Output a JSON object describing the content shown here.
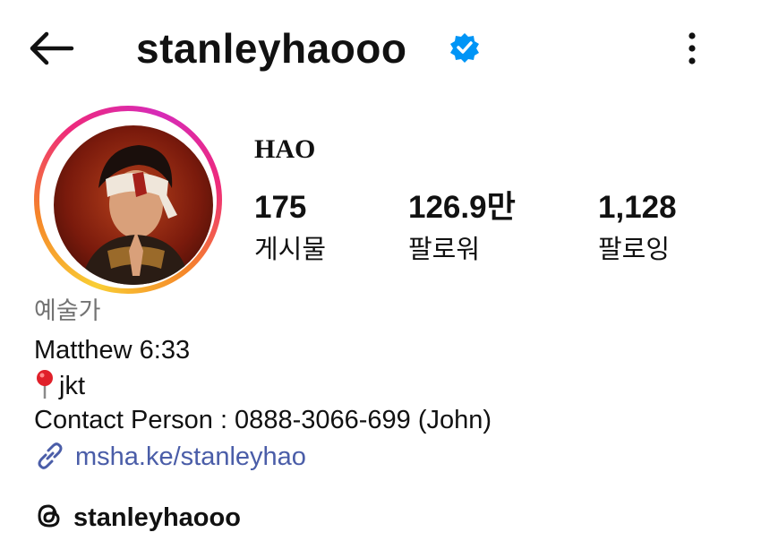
{
  "header": {
    "username": "stanleyhaooo",
    "icons": {
      "back": "back-arrow-icon",
      "verified": "verified-badge-icon",
      "more": "more-vertical-icon"
    },
    "verified_color": "#0095f6"
  },
  "profile": {
    "display_name": "HAO",
    "avatar_ring_colors": [
      "#f9ce34",
      "#ee2a7b",
      "#d62bb8"
    ]
  },
  "stats": [
    {
      "value": "175",
      "label": "게시물"
    },
    {
      "value": "126.9만",
      "label": "팔로워"
    },
    {
      "value": "1,128",
      "label": "팔로잉"
    }
  ],
  "bio": {
    "category": "예술가",
    "lines": {
      "verse": "Matthew 6:33",
      "location": "jkt",
      "contact": "Contact Person : 0888-3066-699 (John)"
    },
    "link": "msha.ke/stanleyhao",
    "link_color": "#4a5da8"
  },
  "threads": {
    "handle": "stanleyhaooo",
    "icon": "threads-icon"
  }
}
